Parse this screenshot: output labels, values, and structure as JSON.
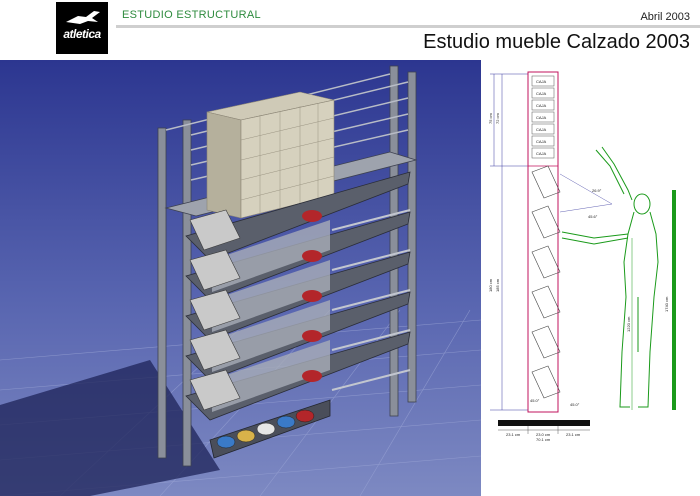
{
  "header": {
    "logo_text": "atletica",
    "section_label": "ESTUDIO ESTRUCTURAL",
    "date": "Abril 2003",
    "title": "Estudio mueble Calzado 2003"
  },
  "drawing": {
    "box_label": "CAJA",
    "angle_top": "26.9°",
    "angle_mid": "45.6°",
    "angle_bottom_left": "45.0°",
    "angle_bottom_right": "45.0°",
    "dim_upper_1": "75 cm",
    "dim_upper_2": "72 cm",
    "dim_total_1": "180 cm",
    "dim_total_2": "185 cm",
    "dim_reach": "1220 cm",
    "dim_person": "1740 cm",
    "dim_base_1": "23.1 cm",
    "dim_base_2": "23.0 cm",
    "dim_base_3": "23.1 cm",
    "dim_base_total": "70.1 cm"
  },
  "colors": {
    "brand_green": "#2e8b3e",
    "figure_green": "#1a9a1a",
    "frame_red": "#c0135c",
    "render_sky_top": "#2f3a8f",
    "render_floor": "#6e7bb8"
  }
}
